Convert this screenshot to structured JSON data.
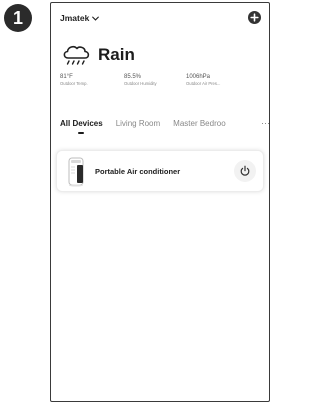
{
  "step_number": "1",
  "header": {
    "home_name": "Jmatek",
    "chevron_icon": "chevron-down-icon",
    "add_icon": "add-circle-icon"
  },
  "weather": {
    "icon": "rain-cloud-icon",
    "condition": "Rain",
    "metrics": [
      {
        "value": "81°F",
        "label": "Outdoor Temp."
      },
      {
        "value": "85.5%",
        "label": "Outdoor Humidity"
      },
      {
        "value": "1006hPa",
        "label": "Outdoor Air Pres..."
      }
    ]
  },
  "tabs": {
    "items": [
      {
        "label": "All Devices",
        "active": true
      },
      {
        "label": "Living Room",
        "active": false
      },
      {
        "label": "Master Bedroo",
        "active": false
      }
    ],
    "more_icon": "more-dots-icon",
    "more_glyph": "···"
  },
  "devices": [
    {
      "name": "Portable Air conditioner",
      "icon": "portable-air-conditioner-icon",
      "power_icon": "power-icon"
    }
  ],
  "colors": {
    "badge": "#2b2b2b",
    "text_primary": "#1c1c1c",
    "text_secondary": "#888888",
    "card_bg": "#ffffff",
    "power_bg": "#f2f2f2"
  }
}
